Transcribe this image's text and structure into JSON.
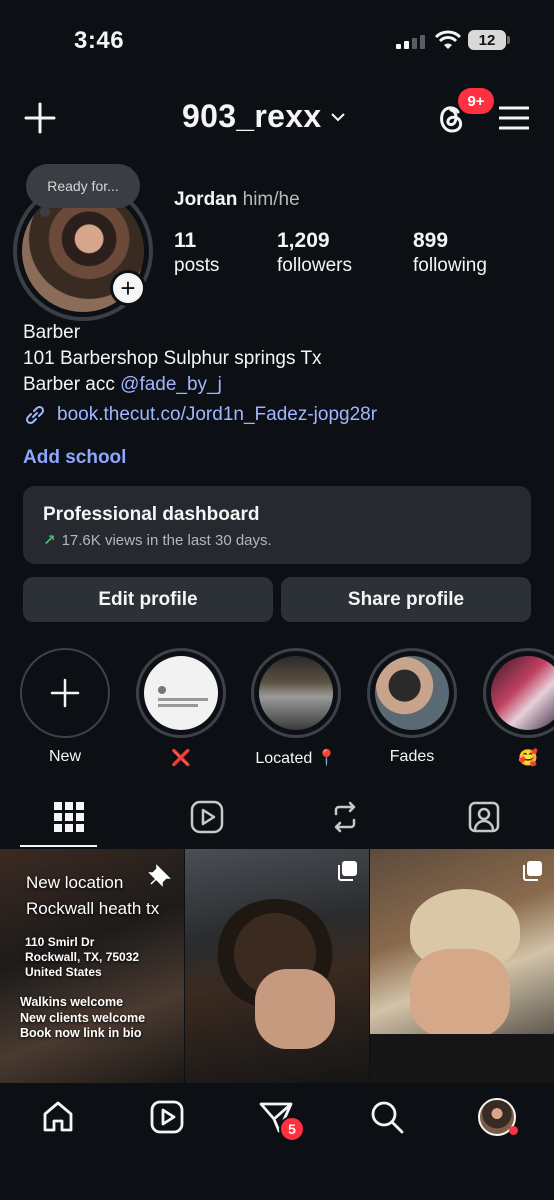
{
  "status_bar": {
    "time": "3:46",
    "battery": "12"
  },
  "header": {
    "username": "903_rexx",
    "notification_badge": "9+"
  },
  "profile": {
    "note": "Ready for...",
    "name": "Jordan",
    "pronouns": "him/he",
    "stats": [
      {
        "value": "11",
        "label": "posts"
      },
      {
        "value": "1,209",
        "label": "followers"
      },
      {
        "value": "899",
        "label": "following"
      }
    ],
    "bio_lines": [
      "Barber",
      "101 Barbershop Sulphur springs Tx"
    ],
    "bio_mention_prefix": "Barber acc",
    "bio_mention": "@fade_by_j",
    "link": "book.thecut.co/Jord1n_Fadez-jopg28r",
    "add_school": "Add school"
  },
  "dashboard": {
    "title": "Professional dashboard",
    "subtitle": "17.6K views in the last 30 days."
  },
  "buttons": {
    "edit": "Edit profile",
    "share": "Share profile"
  },
  "highlights": [
    {
      "label": "New"
    },
    {
      "label": "❌"
    },
    {
      "label": "Located 📍"
    },
    {
      "label": "Fades"
    },
    {
      "label": "🥰"
    }
  ],
  "posts": {
    "post1": {
      "line1": "New location",
      "line2": "Rockwall heath tx",
      "address": [
        "110 Smirl Dr",
        "Rockwall, TX, 75032",
        "United States"
      ],
      "footer": [
        "Walkins welcome",
        "New clients welcome",
        "Book now link in bio"
      ]
    }
  },
  "nav": {
    "dm_badge": "5"
  },
  "colors": {
    "background": "#0c0f14",
    "link": "#a0b6ff",
    "badge": "#ff3040",
    "card": "#262a30"
  }
}
